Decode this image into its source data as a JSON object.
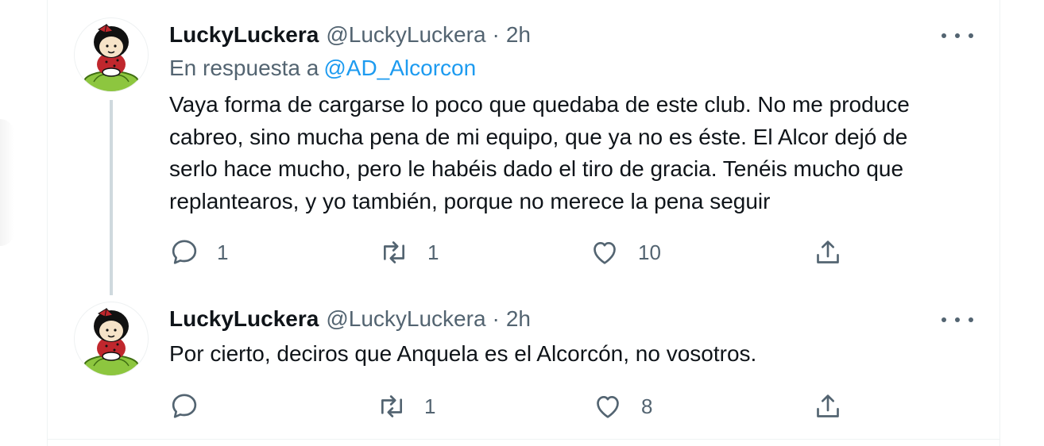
{
  "thread": {
    "tweets": [
      {
        "display_name": "LuckyLuckera",
        "handle": "@LuckyLuckera",
        "separator": "·",
        "time": "2h",
        "reply_prefix": "En respuesta a",
        "reply_to": "@AD_Alcorcon",
        "text": "Vaya forma de cargarse lo poco que quedaba de este club. No me produce\ncabreo, sino mucha pena de mi equipo, que ya no es éste. El Alcor dejó de\nserlo hace mucho, pero le habéis dado el tiro de gracia. Tenéis mucho que\nreplantearos, y yo también, porque no merece la pena seguir",
        "actions": {
          "replies": "1",
          "retweets": "1",
          "likes": "10"
        }
      },
      {
        "display_name": "LuckyLuckera",
        "handle": "@LuckyLuckera",
        "separator": "·",
        "time": "2h",
        "text": "Por cierto, deciros que Anquela es el Alcorcón, no vosotros.",
        "actions": {
          "replies": "",
          "retweets": "1",
          "likes": "8"
        }
      }
    ]
  },
  "icons": {
    "reply": "speech-bubble-icon",
    "retweet": "retweet-arrows-icon",
    "like": "heart-outline-icon",
    "share": "share-upload-icon",
    "more": "more-dots-icon"
  },
  "colors": {
    "text_primary": "#0f1419",
    "text_secondary": "#536471",
    "link": "#1d9bf0",
    "thread_line": "#cfd9de",
    "divider": "#eff3f4"
  }
}
